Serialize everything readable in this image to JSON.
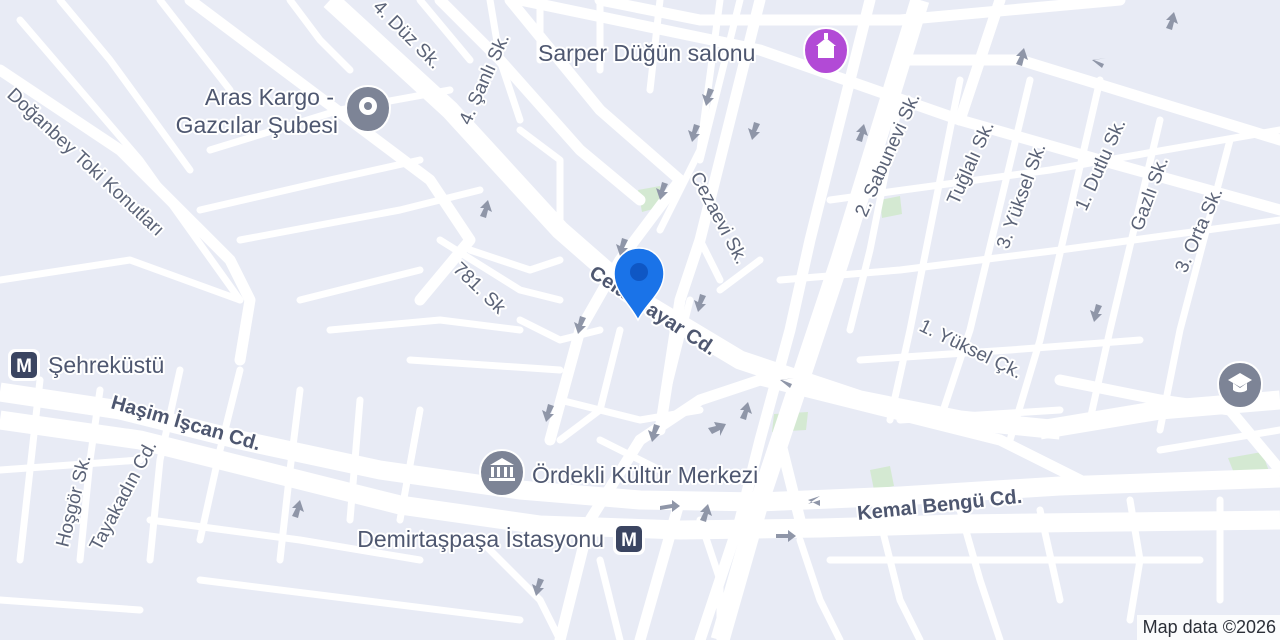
{
  "map": {
    "colors": {
      "land": "#e8ebf5",
      "road": "#ffffff",
      "park": "#d4e9d2",
      "pin": "#1a73e8",
      "pin_dark": "#0f57c4",
      "poi_purple": "#b24ad6",
      "poi_gray": "#7d8496",
      "metro": "#3b4561",
      "arrow": "#8f96a8"
    },
    "streets": [
      {
        "id": "duz",
        "text": "4. Düz Sk."
      },
      {
        "id": "sanli",
        "text": "4. Şanlı Sk."
      },
      {
        "id": "doganbey",
        "text": "Doğanbey Toki Konutları"
      },
      {
        "id": "cezaevi",
        "text": "Cezaevi Sk."
      },
      {
        "id": "sabunevi",
        "text": "2. Sabunevi Sk."
      },
      {
        "id": "tuglali",
        "text": "Tuğlalı Sk."
      },
      {
        "id": "yuksel3",
        "text": "3. Yüksel Sk."
      },
      {
        "id": "dutlu",
        "text": "1. Dutlu Sk."
      },
      {
        "id": "gazli",
        "text": "Gazlı Sk."
      },
      {
        "id": "orta",
        "text": "3. Orta Sk."
      },
      {
        "id": "sk781",
        "text": "781. Sk"
      },
      {
        "id": "yukselck",
        "text": "1. Yüksel Çk."
      },
      {
        "id": "hosgor",
        "text": "Hoşgör Sk."
      },
      {
        "id": "tayakadin",
        "text": "Tayakadın Cd."
      }
    ],
    "major_roads": [
      {
        "id": "celal",
        "text": "Celal Bayar Cd."
      },
      {
        "id": "hasim",
        "text": "Haşim İşcan Cd."
      },
      {
        "id": "kemal",
        "text": "Kemal Bengü Cd."
      }
    ],
    "pois": [
      {
        "id": "sarper",
        "name": "Sarper Düğün salonu",
        "icon": "wedding-hall-icon"
      },
      {
        "id": "aras_line1",
        "name": "Aras Kargo -",
        "icon": "place-icon"
      },
      {
        "id": "aras_line2",
        "name": "Gazcılar Şubesi",
        "icon": "place-icon"
      },
      {
        "id": "ordekli",
        "name": "Ördekli Kültür Merkezi",
        "icon": "museum-icon"
      },
      {
        "id": "demirtas",
        "name": "Demirtaşpaşa İstasyonu",
        "icon": "metro-icon"
      },
      {
        "id": "sehrekustu",
        "name": "Şehreküstü",
        "icon": "metro-icon"
      },
      {
        "id": "school",
        "name": "",
        "icon": "school-icon"
      }
    ],
    "metro_letter": "M",
    "attribution": "Map data ©2026"
  }
}
